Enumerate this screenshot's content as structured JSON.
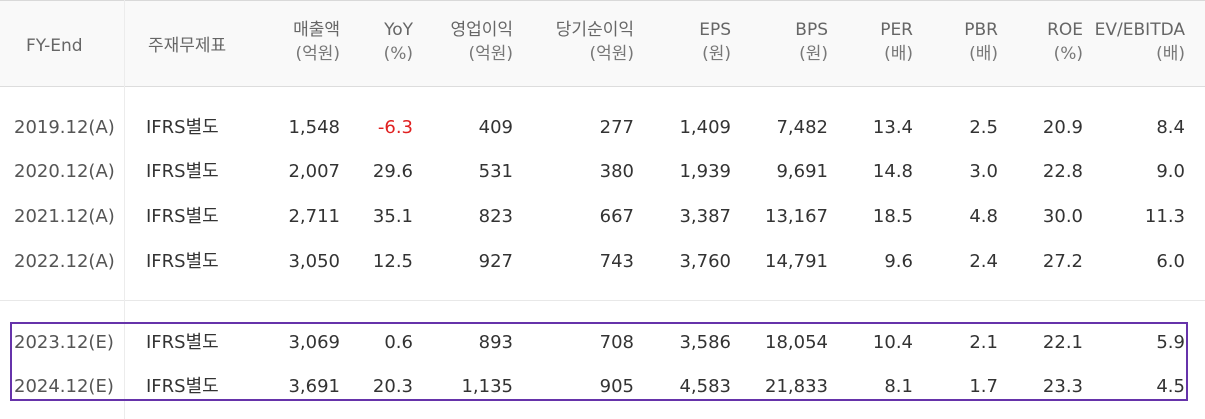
{
  "headers": {
    "fy_end": "FY-End",
    "basis": "주재무제표",
    "sales": {
      "label": "매출액",
      "unit": "(억원)"
    },
    "yoy": {
      "label": "YoY",
      "unit": "(%)"
    },
    "op_income": {
      "label": "영업이익",
      "unit": "(억원)"
    },
    "net_income": {
      "label": "당기순이익",
      "unit": "(억원)"
    },
    "eps": {
      "label": "EPS",
      "unit": "(원)"
    },
    "bps": {
      "label": "BPS",
      "unit": "(원)"
    },
    "per": {
      "label": "PER",
      "unit": "(배)"
    },
    "pbr": {
      "label": "PBR",
      "unit": "(배)"
    },
    "roe": {
      "label": "ROE",
      "unit": "(%)"
    },
    "ev_ebitda": {
      "label": "EV/EBITDA",
      "unit": "(배)"
    }
  },
  "rows": [
    {
      "year": "2019.12(A)",
      "basis": "IFRS별도",
      "sales": "1,548",
      "yoy": "-6.3",
      "op_income": "409",
      "net_income": "277",
      "eps": "1,409",
      "bps": "7,482",
      "per": "13.4",
      "pbr": "2.5",
      "roe": "20.9",
      "ev_ebitda": "8.4"
    },
    {
      "year": "2020.12(A)",
      "basis": "IFRS별도",
      "sales": "2,007",
      "yoy": "29.6",
      "op_income": "531",
      "net_income": "380",
      "eps": "1,939",
      "bps": "9,691",
      "per": "14.8",
      "pbr": "3.0",
      "roe": "22.8",
      "ev_ebitda": "9.0"
    },
    {
      "year": "2021.12(A)",
      "basis": "IFRS별도",
      "sales": "2,711",
      "yoy": "35.1",
      "op_income": "823",
      "net_income": "667",
      "eps": "3,387",
      "bps": "13,167",
      "per": "18.5",
      "pbr": "4.8",
      "roe": "30.0",
      "ev_ebitda": "11.3"
    },
    {
      "year": "2022.12(A)",
      "basis": "IFRS별도",
      "sales": "3,050",
      "yoy": "12.5",
      "op_income": "927",
      "net_income": "743",
      "eps": "3,760",
      "bps": "14,791",
      "per": "9.6",
      "pbr": "2.4",
      "roe": "27.2",
      "ev_ebitda": "6.0"
    },
    {
      "year": "2023.12(E)",
      "basis": "IFRS별도",
      "sales": "3,069",
      "yoy": "0.6",
      "op_income": "893",
      "net_income": "708",
      "eps": "3,586",
      "bps": "18,054",
      "per": "10.4",
      "pbr": "2.1",
      "roe": "22.1",
      "ev_ebitda": "5.9"
    },
    {
      "year": "2024.12(E)",
      "basis": "IFRS별도",
      "sales": "3,691",
      "yoy": "20.3",
      "op_income": "1,135",
      "net_income": "905",
      "eps": "4,583",
      "bps": "21,833",
      "per": "8.1",
      "pbr": "1.7",
      "roe": "23.3",
      "ev_ebitda": "4.5"
    }
  ],
  "colors": {
    "negative": "#e02020",
    "estimate_highlight": "#6633aa",
    "header_bg": "#f9f9f9"
  }
}
